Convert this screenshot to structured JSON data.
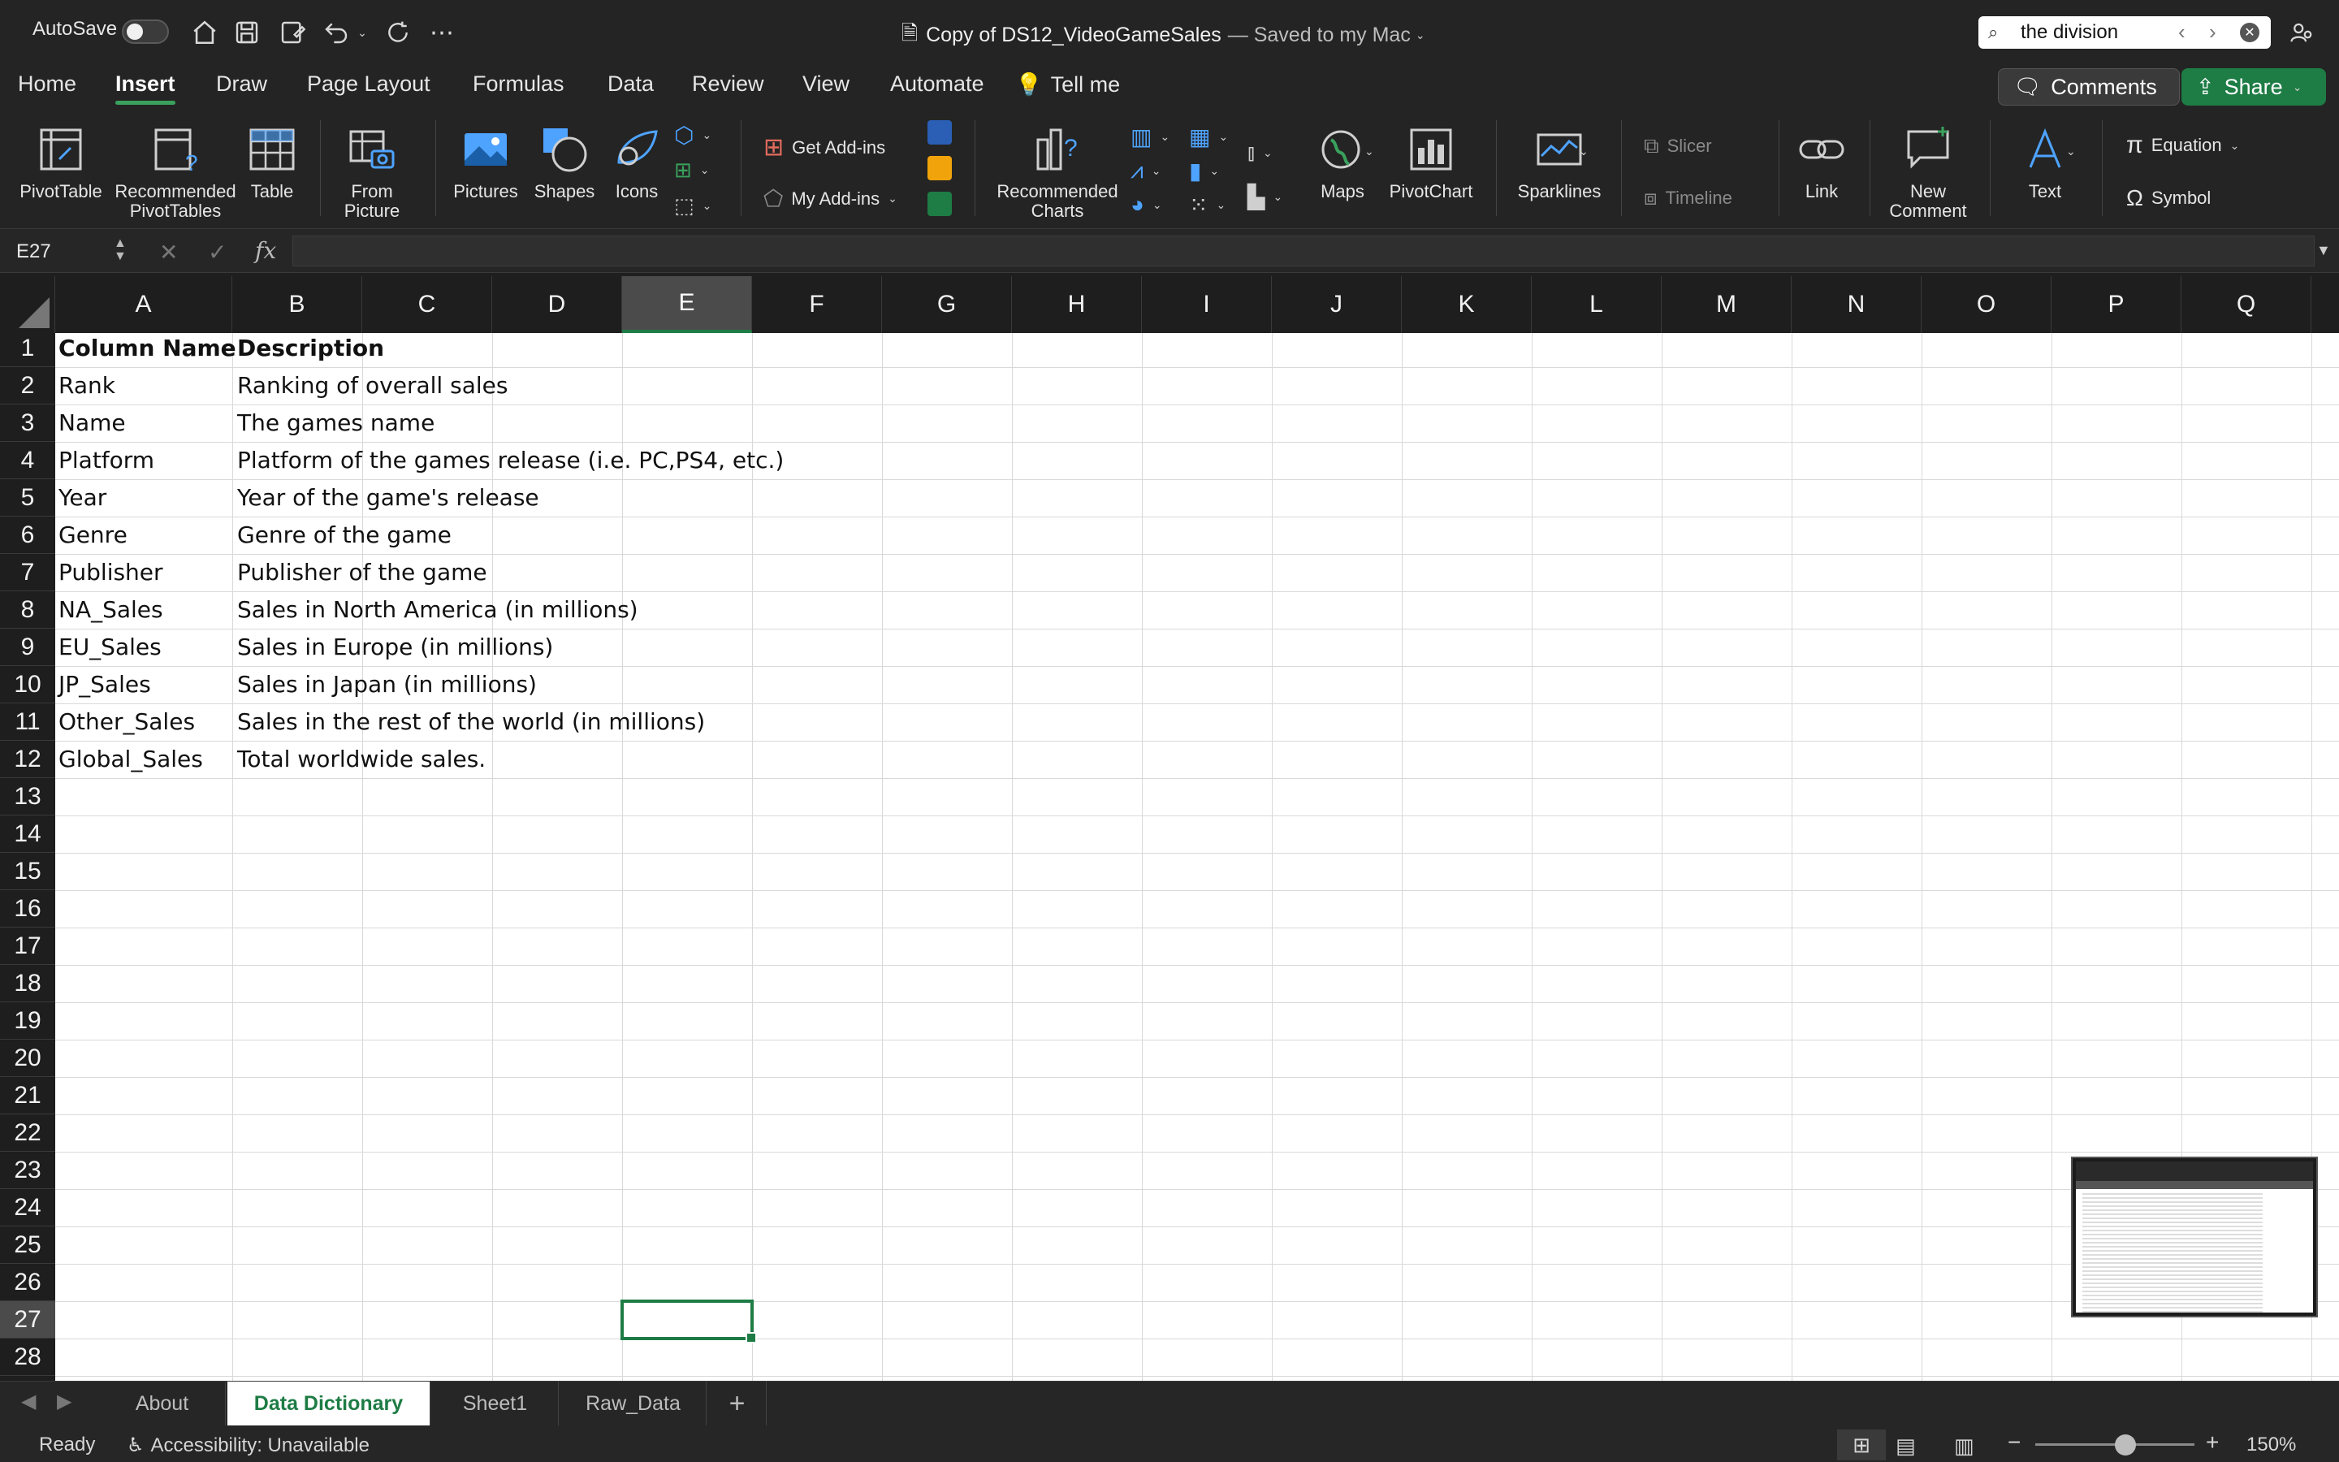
{
  "titlebar": {
    "autosave_label": "AutoSave",
    "doc_name": "Copy of DS12_VideoGameSales",
    "save_status": "— Saved to my Mac",
    "search_value": "the division"
  },
  "ribbon_tabs": [
    "Home",
    "Insert",
    "Draw",
    "Page Layout",
    "Formulas",
    "Data",
    "Review",
    "View",
    "Automate"
  ],
  "tell_me": "Tell me",
  "comments_label": "Comments",
  "share_label": "Share",
  "ribbon": {
    "pivottable": "PivotTable",
    "recommended_pivot_1": "Recommended",
    "recommended_pivot_2": "PivotTables",
    "table": "Table",
    "from_picture_1": "From",
    "from_picture_2": "Picture",
    "pictures": "Pictures",
    "shapes": "Shapes",
    "icons": "Icons",
    "get_addins": "Get Add-ins",
    "my_addins": "My Add-ins",
    "rec_charts_1": "Recommended",
    "rec_charts_2": "Charts",
    "maps": "Maps",
    "pivotchart": "PivotChart",
    "sparklines": "Sparklines",
    "slicer": "Slicer",
    "timeline": "Timeline",
    "link": "Link",
    "new_comment_1": "New",
    "new_comment_2": "Comment",
    "text": "Text",
    "equation": "Equation",
    "symbol": "Symbol"
  },
  "formula_bar": {
    "name_box": "E27",
    "fx": "fx",
    "formula": ""
  },
  "columns": [
    "A",
    "B",
    "C",
    "D",
    "E",
    "F",
    "G",
    "H",
    "I",
    "J",
    "K",
    "L",
    "M",
    "N",
    "O",
    "P",
    "Q"
  ],
  "rows": [
    "1",
    "2",
    "3",
    "4",
    "5",
    "6",
    "7",
    "8",
    "9",
    "10",
    "11",
    "12",
    "13",
    "14",
    "15",
    "16",
    "17",
    "18",
    "19",
    "20",
    "21",
    "22",
    "23",
    "24",
    "25",
    "26",
    "27",
    "28"
  ],
  "table": {
    "header": [
      "Column Name",
      "Description"
    ],
    "rows": [
      [
        "Rank",
        "Ranking of overall sales"
      ],
      [
        "Name",
        "The games name"
      ],
      [
        "Platform",
        "Platform of the games release (i.e. PC,PS4, etc.)"
      ],
      [
        "Year",
        "Year of the game's release"
      ],
      [
        "Genre",
        "Genre of the game"
      ],
      [
        "Publisher",
        "Publisher of the game"
      ],
      [
        "NA_Sales",
        "Sales in North America (in millions)"
      ],
      [
        "EU_Sales",
        "Sales in Europe (in millions)"
      ],
      [
        "JP_Sales",
        "Sales in Japan (in millions)"
      ],
      [
        "Other_Sales",
        "Sales in the rest of the world (in millions)"
      ],
      [
        "Global_Sales",
        "Total worldwide sales."
      ]
    ]
  },
  "sheet_tabs": [
    "About",
    "Data Dictionary",
    "Sheet1",
    "Raw_Data"
  ],
  "active_sheet": "Data Dictionary",
  "status": {
    "ready": "Ready",
    "accessibility": "Accessibility: Unavailable",
    "zoom": "150%"
  },
  "colors": {
    "accent": "#1e7c45",
    "ribbon_bg": "#242424",
    "grid_bg": "#ffffff"
  }
}
